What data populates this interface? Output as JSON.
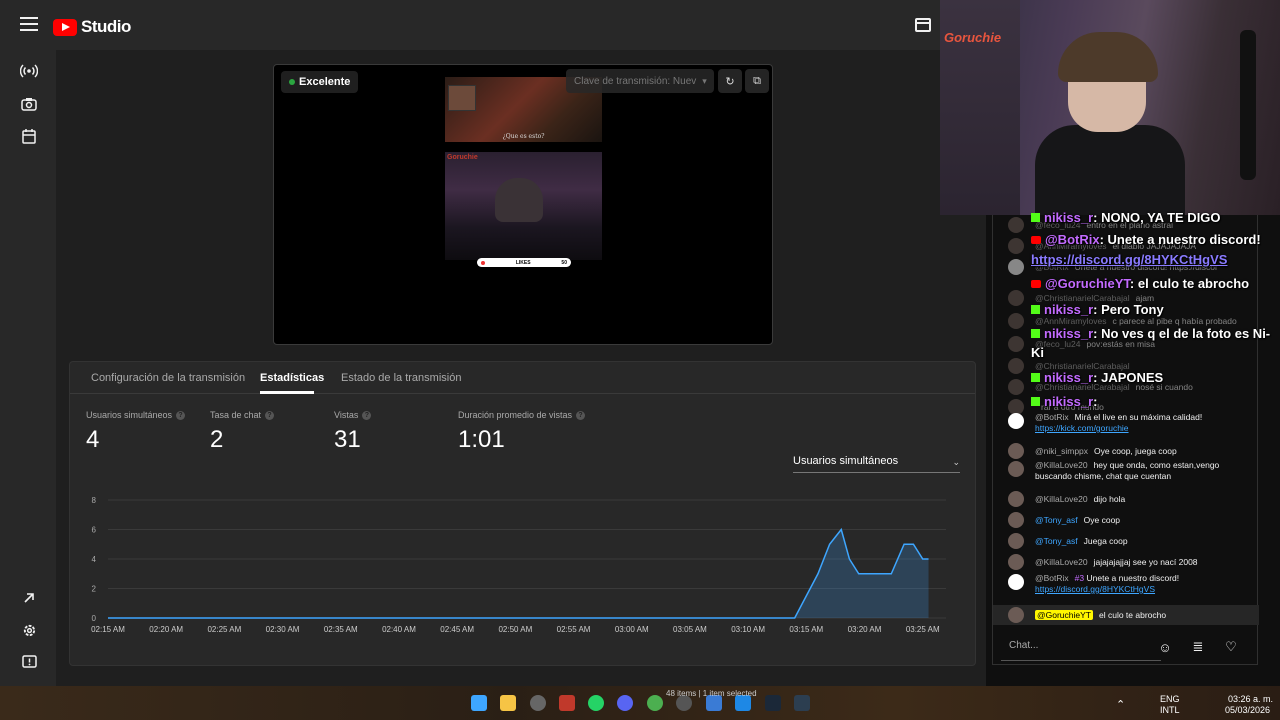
{
  "app": {
    "name": "Studio"
  },
  "preview": {
    "quality_badge": "Excelente",
    "stream_key_placeholder": "Clave de transmisión: Nuev",
    "thumb_caption": "¿Que es esto?",
    "thumb_brand": "Goruchie",
    "likes_label": "LIKES",
    "likes_count": "50"
  },
  "tabs": [
    {
      "label": "Configuración de la transmisión",
      "active": false
    },
    {
      "label": "Estadísticas",
      "active": true
    },
    {
      "label": "Estado de la transmisión",
      "active": false
    }
  ],
  "metrics": [
    {
      "label": "Usuarios simultáneos",
      "value": "4"
    },
    {
      "label": "Tasa de chat",
      "value": "2"
    },
    {
      "label": "Vistas",
      "value": "31"
    },
    {
      "label": "Duración promedio de vistas",
      "value": "1:01"
    }
  ],
  "metric_selector": {
    "selected": "Usuarios simultáneos"
  },
  "chart_data": {
    "type": "area",
    "x_ticks": [
      "02:15 AM",
      "02:20 AM",
      "02:25 AM",
      "02:30 AM",
      "02:35 AM",
      "02:40 AM",
      "02:45 AM",
      "02:50 AM",
      "02:55 AM",
      "03:00 AM",
      "03:05 AM",
      "03:10 AM",
      "03:15 AM",
      "03:20 AM",
      "03:25 AM"
    ],
    "y_ticks": [
      0,
      2,
      4,
      6,
      8
    ],
    "ylim": [
      0,
      8
    ],
    "x_minutes": [
      0,
      59,
      60,
      61,
      62,
      62.5,
      63,
      63.7,
      64.5,
      65.2,
      66,
      67.3,
      68.4,
      69.2,
      70,
      70.5
    ],
    "values": [
      0,
      0,
      1.5,
      3,
      5,
      5.5,
      6,
      4,
      3,
      3,
      3,
      3,
      5,
      5,
      4,
      4
    ],
    "color": "#3ea6ff"
  },
  "webcam": {
    "brand": "Goruchie"
  },
  "alerts": [
    {
      "platform": "kick",
      "name": "nikiss_r",
      "text": ": NONO, YA TE DIGO"
    },
    {
      "platform": "yt",
      "name": "@BotRix",
      "text": ": Unete a nuestro discord!"
    },
    {
      "platform": "none",
      "name": "",
      "text": "https://discord.gg/8HYKCtHgVS"
    },
    {
      "platform": "yt",
      "name": "@GoruchieYT",
      "text": ": el culo te abrocho"
    },
    {
      "platform": "kick",
      "name": "nikiss_r",
      "text": ": Pero Tony"
    },
    {
      "platform": "kick",
      "name": "nikiss_r",
      "text": ": No ves q el de la foto es Ni-"
    },
    {
      "platform": "none",
      "name": "",
      "text": "Ki"
    },
    {
      "platform": "kick",
      "name": "nikiss_r",
      "text": ": JAPONES"
    },
    {
      "platform": "kick",
      "name": "nikiss_r",
      "text": ":"
    }
  ],
  "chat": {
    "messages": [
      {
        "author": "@feco_lu24",
        "text": "entro en el plano astral",
        "dim": true
      },
      {
        "author": "@AnnMiramyloves",
        "text": "el diablo JAJAJAJAJA",
        "dim": true
      },
      {
        "author": "@BotRix",
        "text": "Unete a nuestro discord! https://discor",
        "dim": true
      },
      {
        "author": "@ChristianarielCarabajal",
        "text": "ajam",
        "dim": true
      },
      {
        "author": "@AnnMiramyloves",
        "text": "c parece al pibe q había probado",
        "dim": true
      },
      {
        "author": "@feco_lu24",
        "text": "pov:estás en misa",
        "dim": true
      },
      {
        "author": "@ChristianarielCarabajal",
        "text": "",
        "dim": true
      },
      {
        "author": "@ChristianarielCarabajal",
        "text": "nosé si cuando",
        "dim": true
      },
      {
        "author": "",
        "text": "rar a otro mundo",
        "dim": true
      },
      {
        "author": "@BotRix",
        "text": "Mirá el live en su máxima calidad!",
        "link": "https://kick.com/goruchie"
      },
      {
        "author": "@niki_simppx",
        "text": "Oye coop, juega coop"
      },
      {
        "author": "@KillaLove20",
        "text": "hey que onda, como estan,vengo buscando chisme, chat que cuentan"
      },
      {
        "author": "@KillaLove20",
        "text": "dijo hola"
      },
      {
        "author": "@Tony_asf",
        "text": "Oye coop"
      },
      {
        "author": "@Tony_asf",
        "text": "Juega coop"
      },
      {
        "author": "@KillaLove20",
        "text": "jajajajajjaj see yo nací 2008"
      },
      {
        "author": "@BotRix",
        "badge": "#3",
        "text": "Unete a nuestro discord!",
        "link": "https://discord.gg/8HYKCtHgVS"
      },
      {
        "author": "@GoruchieYT",
        "text": "el culo te abrocho",
        "highlight": true
      }
    ],
    "input_placeholder": "Chat..."
  },
  "taskbar": {
    "status": "48 items  |  1 item selected",
    "lang_top": "ENG",
    "lang_bottom": "INTL",
    "time": "03:26 a. m.",
    "date": "05/03/2026"
  }
}
